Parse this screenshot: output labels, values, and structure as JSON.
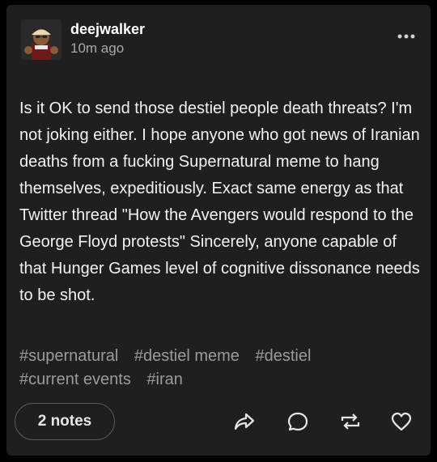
{
  "post": {
    "username": "deejwalker",
    "timestamp": "10m ago",
    "body": "Is it OK to send those destiel people death threats? I'm not joking either. I hope anyone who got news of Iranian deaths from a fucking Supernatural meme to hang themselves, expeditiously. Exact same energy as that Twitter thread \"How the Avengers would respond to the George Floyd protests\" Sincerely, anyone capable of that Hunger Games level of cognitive dissonance needs to be shot.",
    "tags": [
      "#supernatural",
      "#destiel meme",
      "#destiel",
      "#current events",
      "#iran"
    ],
    "notes_label": "2 notes"
  },
  "icons": {
    "more": "more-dots-icon",
    "share": "share-arrow-icon",
    "reply": "reply-bubble-icon",
    "reblog": "reblog-icon",
    "like": "heart-icon"
  },
  "colors": {
    "background": "#000000",
    "card": "#1f1f1f",
    "text": "#f2f2f2",
    "tag": "#9b9b9b"
  }
}
